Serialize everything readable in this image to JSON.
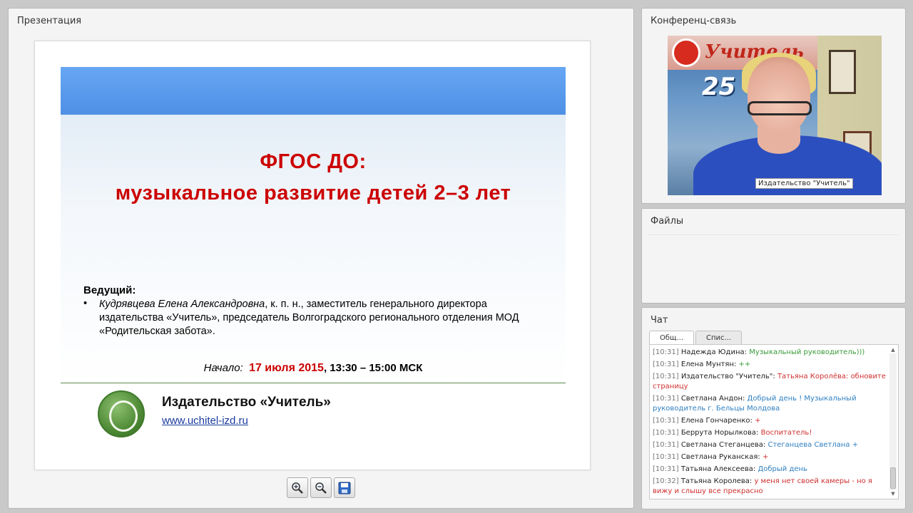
{
  "presentation": {
    "panel_title": "Презентация",
    "slide": {
      "title_line1": "ФГОС ДО:",
      "title_line2": "музыкальное развитие детей 2–3 лет",
      "host_label": "Ведущий:",
      "host_name": "Кудрявцева Елена Александровна",
      "host_details": ", к. п. н., заместитель генерального директора издательства «Учитель», председатель Волгоградского регионального отделения МОД «Родительская забота».",
      "start_label": "Начало:",
      "start_date": "17 июля 2015",
      "start_time": ", 13:30 – 15:00 МСК",
      "publisher_name": "Издательство «Учитель»",
      "publisher_url": "www.uchitel-izd.ru"
    },
    "toolbar": {
      "zoom_in_icon": "zoom-in-icon",
      "zoom_out_icon": "zoom-out-icon",
      "save_icon": "save-icon"
    }
  },
  "video": {
    "panel_title": "Конференц-связь",
    "participant_name": "Издательство \"Учитель\"",
    "banner_word": "Учитель",
    "banner_number": "25"
  },
  "files": {
    "panel_title": "Файлы"
  },
  "chat": {
    "panel_title": "Чат",
    "tabs": [
      {
        "label": "Общ..."
      },
      {
        "label": "Спис..."
      }
    ],
    "messages": [
      {
        "time": "[10:31]",
        "author": "Надежда Юдина:",
        "text": "Музыкальный руководитель)))",
        "color": "#3a9a3a"
      },
      {
        "time": "[10:31]",
        "author": "Елена Мунтян:",
        "text": "++",
        "color": "#3a9a3a"
      },
      {
        "time": "[10:31]",
        "author": "Издательство \"Учитель\":",
        "text": "Татьяна Королёва: обновите страницу",
        "color": "#d03030"
      },
      {
        "time": "[10:31]",
        "author": "Светлана Андон:",
        "text": "Добрый день ! Музыкальный руководитель г. Бельцы Молдова",
        "color": "#2f7fc0"
      },
      {
        "time": "[10:31]",
        "author": "Елена Гончаренко:",
        "text": "+",
        "color": "#d03030"
      },
      {
        "time": "[10:31]",
        "author": "Беррута Норылкова:",
        "text": "Воспитатель!",
        "color": "#d03030"
      },
      {
        "time": "[10:31]",
        "author": "Светлана Стеганцева:",
        "text": "Стеганцева Светлана +",
        "color": "#2f7fc0"
      },
      {
        "time": "[10:31]",
        "author": "Светлана Руканская:",
        "text": "+",
        "color": "#d03030"
      },
      {
        "time": "[10:31]",
        "author": "Татьяна Алексеева:",
        "text": "Добрый день",
        "color": "#2f7fc0"
      },
      {
        "time": "[10:32]",
        "author": "Татьяна Королева:",
        "text": "у меня нет своей камеры - но я вижу и слышу все прекрасно",
        "color": "#d03030"
      }
    ]
  }
}
